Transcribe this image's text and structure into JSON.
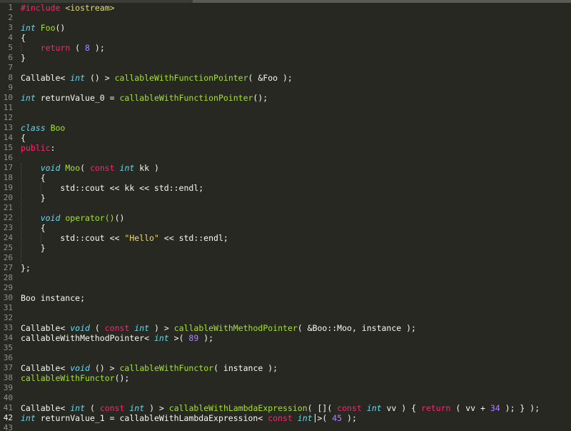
{
  "editor": {
    "theme_colors": {
      "background": "#272822",
      "text": "#f8f8f2",
      "keyword": "#f92672",
      "type": "#66d9ef",
      "function": "#a6e22e",
      "number": "#ae81ff",
      "string": "#e6db74",
      "line_number": "#8f908a"
    },
    "current_line": 42,
    "lines": [
      {
        "n": "1",
        "tokens": [
          {
            "t": "#include ",
            "c": "pp"
          },
          {
            "t": "<iostream>",
            "c": "hdr"
          }
        ]
      },
      {
        "n": "2",
        "tokens": []
      },
      {
        "n": "3",
        "tokens": [
          {
            "t": "int",
            "c": "ty"
          },
          {
            "t": " ",
            "c": "tx"
          },
          {
            "t": "Foo",
            "c": "fn"
          },
          {
            "t": "()",
            "c": "tx"
          }
        ]
      },
      {
        "n": "4",
        "tokens": [
          {
            "t": "{",
            "c": "tx"
          }
        ]
      },
      {
        "n": "5",
        "tokens": [
          {
            "t": "    ",
            "c": "tx"
          },
          {
            "t": "return",
            "c": "kw"
          },
          {
            "t": " ( ",
            "c": "tx"
          },
          {
            "t": "8",
            "c": "num"
          },
          {
            "t": " );",
            "c": "tx"
          }
        ]
      },
      {
        "n": "6",
        "tokens": [
          {
            "t": "}",
            "c": "tx"
          }
        ]
      },
      {
        "n": "7",
        "tokens": []
      },
      {
        "n": "8",
        "tokens": [
          {
            "t": "Callable< ",
            "c": "tx"
          },
          {
            "t": "int",
            "c": "ty"
          },
          {
            "t": " () > ",
            "c": "tx"
          },
          {
            "t": "callableWithFunctionPointer",
            "c": "fn"
          },
          {
            "t": "( &Foo );",
            "c": "tx"
          }
        ]
      },
      {
        "n": "9",
        "tokens": []
      },
      {
        "n": "10",
        "tokens": [
          {
            "t": "int",
            "c": "ty"
          },
          {
            "t": " returnValue_0 = ",
            "c": "tx"
          },
          {
            "t": "callableWithFunctionPointer",
            "c": "fn"
          },
          {
            "t": "();",
            "c": "tx"
          }
        ]
      },
      {
        "n": "11",
        "tokens": []
      },
      {
        "n": "12",
        "tokens": []
      },
      {
        "n": "13",
        "tokens": [
          {
            "t": "class",
            "c": "ty"
          },
          {
            "t": " ",
            "c": "tx"
          },
          {
            "t": "Boo",
            "c": "fn"
          }
        ]
      },
      {
        "n": "14",
        "tokens": [
          {
            "t": "{",
            "c": "tx"
          }
        ]
      },
      {
        "n": "15",
        "tokens": [
          {
            "t": "public",
            "c": "kw"
          },
          {
            "t": ":",
            "c": "tx"
          }
        ]
      },
      {
        "n": "16",
        "tokens": []
      },
      {
        "n": "17",
        "tokens": [
          {
            "t": "    ",
            "c": "tx"
          },
          {
            "t": "void",
            "c": "ty"
          },
          {
            "t": " ",
            "c": "tx"
          },
          {
            "t": "Moo",
            "c": "fn"
          },
          {
            "t": "( ",
            "c": "tx"
          },
          {
            "t": "const",
            "c": "kw"
          },
          {
            "t": " ",
            "c": "tx"
          },
          {
            "t": "int",
            "c": "ty"
          },
          {
            "t": " kk )",
            "c": "tx"
          }
        ]
      },
      {
        "n": "18",
        "tokens": [
          {
            "t": "    {",
            "c": "tx"
          }
        ]
      },
      {
        "n": "19",
        "tokens": [
          {
            "t": "        std::cout << kk << std::endl;",
            "c": "tx"
          }
        ]
      },
      {
        "n": "20",
        "tokens": [
          {
            "t": "    }",
            "c": "tx"
          }
        ]
      },
      {
        "n": "21",
        "tokens": []
      },
      {
        "n": "22",
        "tokens": [
          {
            "t": "    ",
            "c": "tx"
          },
          {
            "t": "void",
            "c": "ty"
          },
          {
            "t": " ",
            "c": "tx"
          },
          {
            "t": "operator()",
            "c": "fn"
          },
          {
            "t": "()",
            "c": "tx"
          }
        ]
      },
      {
        "n": "23",
        "tokens": [
          {
            "t": "    {",
            "c": "tx"
          }
        ]
      },
      {
        "n": "24",
        "tokens": [
          {
            "t": "        std::cout << ",
            "c": "tx"
          },
          {
            "t": "\"Hello\"",
            "c": "str"
          },
          {
            "t": " << std::endl;",
            "c": "tx"
          }
        ]
      },
      {
        "n": "25",
        "tokens": [
          {
            "t": "    }",
            "c": "tx"
          }
        ]
      },
      {
        "n": "26",
        "tokens": []
      },
      {
        "n": "27",
        "tokens": [
          {
            "t": "};",
            "c": "tx"
          }
        ]
      },
      {
        "n": "28",
        "tokens": []
      },
      {
        "n": "29",
        "tokens": []
      },
      {
        "n": "30",
        "tokens": [
          {
            "t": "Boo instance;",
            "c": "tx"
          }
        ]
      },
      {
        "n": "31",
        "tokens": []
      },
      {
        "n": "32",
        "tokens": []
      },
      {
        "n": "33",
        "tokens": [
          {
            "t": "Callable< ",
            "c": "tx"
          },
          {
            "t": "void",
            "c": "ty"
          },
          {
            "t": " ( ",
            "c": "tx"
          },
          {
            "t": "const",
            "c": "kw"
          },
          {
            "t": " ",
            "c": "tx"
          },
          {
            "t": "int",
            "c": "ty"
          },
          {
            "t": " ) > ",
            "c": "tx"
          },
          {
            "t": "callableWithMethodPointer",
            "c": "fn"
          },
          {
            "t": "( &Boo::Moo, instance );",
            "c": "tx"
          }
        ]
      },
      {
        "n": "34",
        "tokens": [
          {
            "t": "callableWithMethodPointer< ",
            "c": "tx"
          },
          {
            "t": "int",
            "c": "ty"
          },
          {
            "t": " >( ",
            "c": "tx"
          },
          {
            "t": "89",
            "c": "num"
          },
          {
            "t": " );",
            "c": "tx"
          }
        ]
      },
      {
        "n": "35",
        "tokens": []
      },
      {
        "n": "36",
        "tokens": []
      },
      {
        "n": "37",
        "tokens": [
          {
            "t": "Callable< ",
            "c": "tx"
          },
          {
            "t": "void",
            "c": "ty"
          },
          {
            "t": " () > ",
            "c": "tx"
          },
          {
            "t": "callableWithFunctor",
            "c": "fn"
          },
          {
            "t": "( instance );",
            "c": "tx"
          }
        ]
      },
      {
        "n": "38",
        "tokens": [
          {
            "t": "callableWithFunctor",
            "c": "fn"
          },
          {
            "t": "();",
            "c": "tx"
          }
        ]
      },
      {
        "n": "39",
        "tokens": []
      },
      {
        "n": "40",
        "tokens": []
      },
      {
        "n": "41",
        "tokens": [
          {
            "t": "Callable< ",
            "c": "tx"
          },
          {
            "t": "int",
            "c": "ty"
          },
          {
            "t": " ( ",
            "c": "tx"
          },
          {
            "t": "const",
            "c": "kw"
          },
          {
            "t": " ",
            "c": "tx"
          },
          {
            "t": "int",
            "c": "ty"
          },
          {
            "t": " ) > ",
            "c": "tx"
          },
          {
            "t": "callableWithLambdaExpression",
            "c": "fn"
          },
          {
            "t": "( [](",
            "c": "tx"
          },
          {
            "t": " const",
            "c": "kw"
          },
          {
            "t": " ",
            "c": "tx"
          },
          {
            "t": "int",
            "c": "ty"
          },
          {
            "t": " vv ) { ",
            "c": "tx"
          },
          {
            "t": "return",
            "c": "kw"
          },
          {
            "t": " ( vv + ",
            "c": "tx"
          },
          {
            "t": "34",
            "c": "num"
          },
          {
            "t": " ); } );",
            "c": "tx"
          }
        ]
      },
      {
        "n": "42",
        "tokens": [
          {
            "t": "int",
            "c": "ty"
          },
          {
            "t": " returnValue_1 = callableWithLambdaExpression< ",
            "c": "tx"
          },
          {
            "t": "const",
            "c": "kw"
          },
          {
            "t": " ",
            "c": "tx"
          },
          {
            "t": "int",
            "c": "ty"
          },
          {
            "t": " >( ",
            "c": "tx"
          },
          {
            "t": "45",
            "c": "num"
          },
          {
            "t": " );",
            "c": "tx"
          }
        ]
      },
      {
        "n": "43",
        "tokens": []
      }
    ]
  }
}
